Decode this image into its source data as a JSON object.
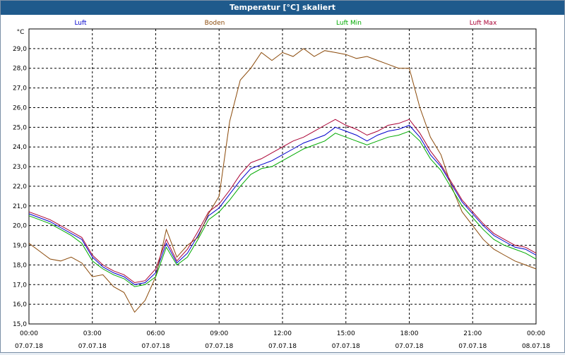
{
  "window": {
    "title": "Temperatur [°C] skaliert"
  },
  "colors": {
    "luft": "#0000cc",
    "boden": "#8b4a0a",
    "luft_min": "#00aa00",
    "luft_max": "#aa0033",
    "grid": "#000000"
  },
  "chart_data": {
    "type": "line",
    "title": "Temperatur [°C] skaliert",
    "ylabel": "°C",
    "xlabel": "",
    "ylim": [
      15.0,
      30.0
    ],
    "xlim": [
      0,
      24
    ],
    "grid": true,
    "legend_placement": "top",
    "y_ticks": [
      "15,0",
      "16,0",
      "17,0",
      "18,0",
      "19,0",
      "20,0",
      "21,0",
      "22,0",
      "23,0",
      "24,0",
      "25,0",
      "26,0",
      "27,0",
      "28,0",
      "29,0"
    ],
    "x_ticks": [
      {
        "time": "00:00",
        "date": "07.07.18"
      },
      {
        "time": "03:00",
        "date": "07.07.18"
      },
      {
        "time": "06:00",
        "date": "07.07.18"
      },
      {
        "time": "09:00",
        "date": "07.07.18"
      },
      {
        "time": "12:00",
        "date": "07.07.18"
      },
      {
        "time": "15:00",
        "date": "07.07.18"
      },
      {
        "time": "18:00",
        "date": "07.07.18"
      },
      {
        "time": "21:00",
        "date": "07.07.18"
      },
      {
        "time": "00:00",
        "date": "08.07.18"
      }
    ],
    "x": [
      0,
      0.5,
      1,
      1.5,
      2,
      2.5,
      3,
      3.5,
      4,
      4.5,
      5,
      5.5,
      6,
      6.5,
      7,
      7.5,
      8,
      8.5,
      9,
      9.5,
      10,
      10.5,
      11,
      11.5,
      12,
      12.5,
      13,
      13.5,
      14,
      14.5,
      15,
      15.5,
      16,
      16.5,
      17,
      17.5,
      18,
      18.5,
      19,
      19.5,
      20,
      20.5,
      21,
      21.5,
      22,
      22.5,
      23,
      23.5,
      24
    ],
    "series": [
      {
        "name": "Luft",
        "color_key": "luft",
        "values": [
          20.6,
          20.4,
          20.2,
          19.9,
          19.6,
          19.3,
          18.4,
          17.9,
          17.6,
          17.4,
          17.0,
          17.1,
          17.6,
          19.1,
          18.1,
          18.6,
          19.5,
          20.5,
          20.9,
          21.6,
          22.3,
          22.9,
          23.1,
          23.3,
          23.6,
          23.9,
          24.2,
          24.4,
          24.6,
          25.0,
          24.8,
          24.6,
          24.3,
          24.6,
          24.8,
          24.9,
          25.1,
          24.5,
          23.6,
          23.0,
          22.1,
          21.2,
          20.6,
          20.0,
          19.5,
          19.2,
          18.9,
          18.8,
          18.5
        ]
      },
      {
        "name": "Boden",
        "color_key": "boden",
        "values": [
          19.1,
          18.7,
          18.3,
          18.2,
          18.4,
          18.1,
          17.4,
          17.5,
          16.9,
          16.6,
          15.6,
          16.2,
          17.4,
          19.8,
          18.4,
          19.0,
          19.4,
          20.6,
          21.5,
          25.3,
          27.4,
          28.0,
          28.8,
          28.4,
          28.8,
          28.6,
          29.0,
          28.6,
          28.9,
          28.8,
          28.7,
          28.5,
          28.6,
          28.4,
          28.2,
          28.0,
          28.0,
          26.0,
          24.5,
          23.6,
          22.0,
          20.7,
          20.0,
          19.3,
          18.8,
          18.5,
          18.2,
          18.0,
          17.8
        ]
      },
      {
        "name": "Luft Min",
        "color_key": "luft_min",
        "values": [
          20.5,
          20.3,
          20.1,
          19.8,
          19.5,
          19.1,
          18.2,
          17.8,
          17.5,
          17.3,
          16.9,
          17.0,
          17.4,
          18.9,
          18.0,
          18.4,
          19.3,
          20.3,
          20.7,
          21.3,
          22.0,
          22.6,
          22.9,
          23.0,
          23.3,
          23.6,
          23.9,
          24.1,
          24.3,
          24.7,
          24.5,
          24.3,
          24.1,
          24.3,
          24.5,
          24.6,
          24.8,
          24.3,
          23.4,
          22.8,
          21.9,
          21.0,
          20.4,
          19.8,
          19.3,
          19.0,
          18.8,
          18.6,
          18.3
        ]
      },
      {
        "name": "Luft Max",
        "color_key": "luft_max",
        "values": [
          20.7,
          20.5,
          20.3,
          20.0,
          19.7,
          19.4,
          18.5,
          18.0,
          17.7,
          17.5,
          17.1,
          17.2,
          17.8,
          19.3,
          18.2,
          18.8,
          19.7,
          20.7,
          21.1,
          21.8,
          22.6,
          23.2,
          23.4,
          23.7,
          24.0,
          24.3,
          24.5,
          24.8,
          25.1,
          25.4,
          25.1,
          24.9,
          24.6,
          24.8,
          25.1,
          25.2,
          25.4,
          24.7,
          23.8,
          23.1,
          22.2,
          21.3,
          20.7,
          20.1,
          19.6,
          19.3,
          19.0,
          18.9,
          18.6
        ]
      }
    ]
  }
}
